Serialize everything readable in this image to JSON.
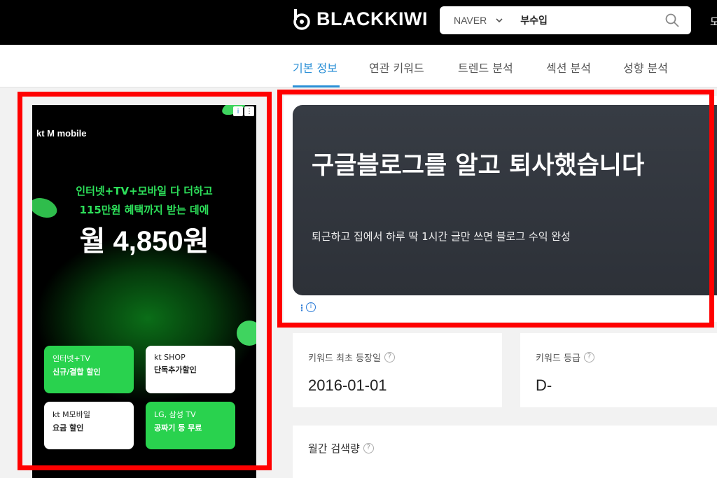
{
  "header": {
    "logo_text": "BLACKKIWI",
    "search": {
      "engine": "NAVER",
      "query": "부수입"
    },
    "right_cut_text": "모"
  },
  "tabs": [
    {
      "label": "기본 정보",
      "active": true
    },
    {
      "label": "연관 키워드",
      "active": false
    },
    {
      "label": "트렌드 분석",
      "active": false
    },
    {
      "label": "섹션 분석",
      "active": false
    },
    {
      "label": "성향 분석",
      "active": false
    }
  ],
  "left_ad": {
    "brand": "kt M mobile",
    "headline1": "인터넷+TV+모바일 다 더하고",
    "headline2": "115만원 혜택까지 받는 데에",
    "price": "월 4,850원",
    "tiles": [
      {
        "line1": "인터넷+TV",
        "line2": "신규/결합 할인"
      },
      {
        "line1": "kt SHOP",
        "line2": "단독추가할인"
      },
      {
        "line1": "kt M모바일",
        "line2": "요금 할인"
      },
      {
        "line1": "LG, 삼성 TV",
        "line2": "공짜기 등 무료"
      }
    ]
  },
  "right_ad": {
    "title": "구글블로그를 알고 퇴사했습니다",
    "subtitle": "퇴근하고 집에서 하루 딱 1시간 글만 쓰면 블로그 수익 완성"
  },
  "stats": [
    {
      "label": "키워드 최초 등장일",
      "value": "2016-01-01"
    },
    {
      "label": "키워드 등급",
      "value": "D-"
    }
  ],
  "monthly": {
    "label": "월간 검색량"
  },
  "colors": {
    "accent": "#2a8fd6",
    "highlight": "#ff0000",
    "ad_green": "#29d24e"
  }
}
